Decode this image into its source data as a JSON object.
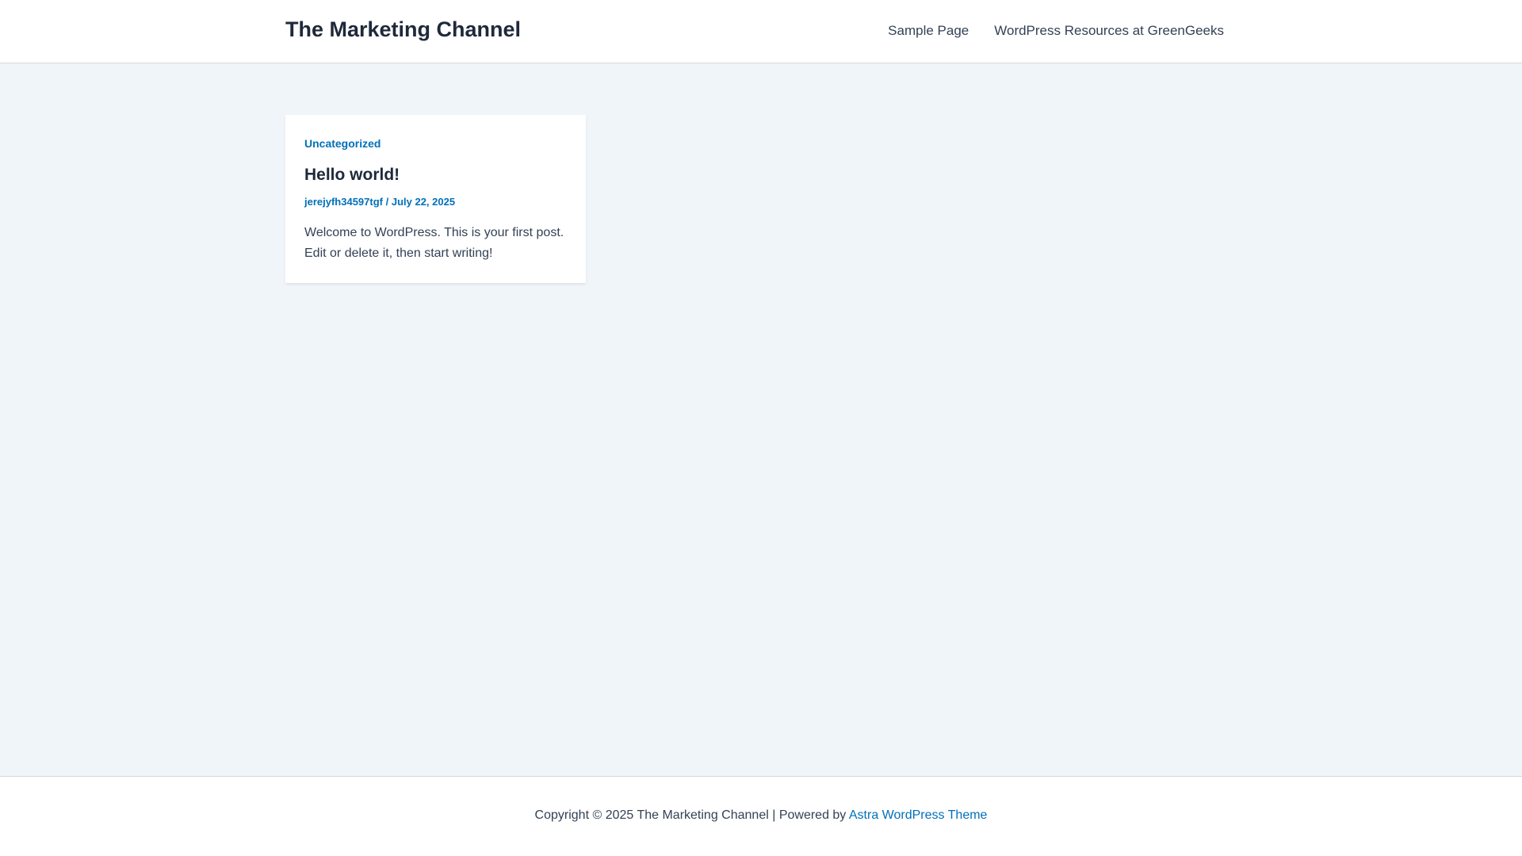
{
  "header": {
    "site_title": "The Marketing Channel",
    "nav": [
      {
        "label": "Sample Page"
      },
      {
        "label": "WordPress Resources at GreenGeeks"
      }
    ]
  },
  "post": {
    "category": "Uncategorized",
    "title": "Hello world!",
    "author": "jerejyfh34597tgf",
    "separator": " / ",
    "date": "July 22, 2025",
    "excerpt": "Welcome to WordPress. This is your first post. Edit or delete it, then start writing!"
  },
  "footer": {
    "copyright": "Copyright © 2025 The Marketing Channel | Powered by ",
    "theme_link": "Astra WordPress Theme"
  },
  "colors": {
    "accent": "#0170b9",
    "content_bg": "#f0f5fa",
    "heading": "#1e293b"
  }
}
